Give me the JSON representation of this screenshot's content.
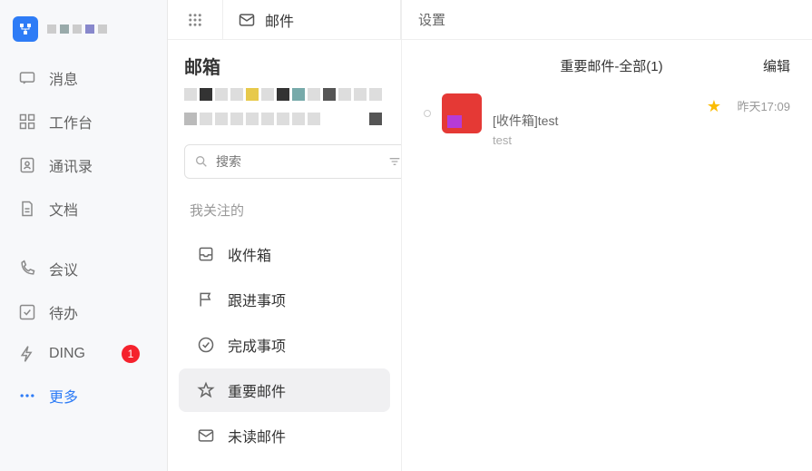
{
  "sidebar": {
    "items": [
      {
        "label": "消息"
      },
      {
        "label": "工作台"
      },
      {
        "label": "通讯录"
      },
      {
        "label": "文档"
      },
      {
        "label": "会议"
      },
      {
        "label": "待办"
      },
      {
        "label": "DING",
        "badge": "1"
      },
      {
        "label": "更多"
      }
    ]
  },
  "mid": {
    "tab_label": "邮件",
    "title": "邮箱",
    "search_placeholder": "搜索",
    "section": "我关注的",
    "folders": [
      {
        "label": "收件箱"
      },
      {
        "label": "跟进事项"
      },
      {
        "label": "完成事项"
      },
      {
        "label": "重要邮件",
        "active": true
      },
      {
        "label": "未读邮件"
      }
    ]
  },
  "right": {
    "settings": "设置",
    "list_title": "重要邮件-全部(1)",
    "edit": "编辑",
    "mails": [
      {
        "sender": "",
        "subject": "[收件箱]test",
        "preview": "test",
        "time": "昨天17:09",
        "starred": true
      }
    ]
  }
}
